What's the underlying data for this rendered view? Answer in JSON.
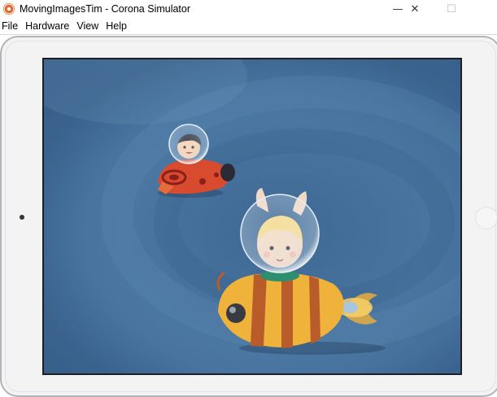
{
  "window": {
    "title": "MovingImagesTim - Corona Simulator",
    "app_icon": "corona-icon",
    "controls": {
      "minimize": "—",
      "maximize": "☐",
      "close": "✕"
    }
  },
  "menu": {
    "items": [
      "File",
      "Hardware",
      "View",
      "Help"
    ]
  },
  "device": {
    "type": "tablet",
    "frame_color": "#f3f3f4",
    "screen_color": "#446f9a"
  },
  "scene": {
    "sprites": [
      "ladybug-ship-with-boy-sprite",
      "bee-ship-with-bunny-girl-sprite"
    ]
  }
}
